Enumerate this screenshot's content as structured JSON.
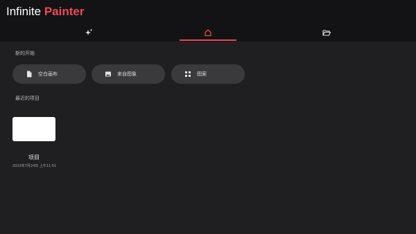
{
  "app": {
    "title_prefix": "Infinite ",
    "title_accent": "Painter"
  },
  "tabs": [
    {
      "icon": "sparkle-icon",
      "active": false
    },
    {
      "icon": "home-icon",
      "active": true
    },
    {
      "icon": "folder-open-icon",
      "active": false
    }
  ],
  "colors": {
    "accent": "#ee4a55",
    "background": "#1f1f21",
    "topbar": "#131315",
    "pill": "#3a3a3d"
  },
  "new_start": {
    "label": "新的开始",
    "actions": [
      {
        "label": "空白画布",
        "icon": "document-icon"
      },
      {
        "label": "来自图象",
        "icon": "image-icon"
      },
      {
        "label": "图案",
        "icon": "pattern-icon"
      }
    ]
  },
  "recent": {
    "label": "最近的项目",
    "projects": [
      {
        "name": "项目",
        "date": "2023年7月24日 上午11:51"
      }
    ]
  }
}
